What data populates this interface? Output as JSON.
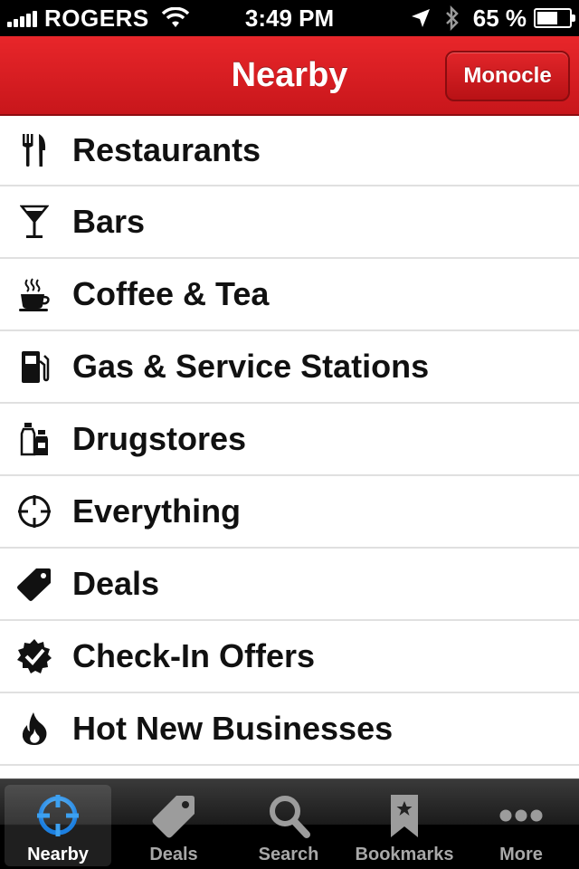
{
  "status_bar": {
    "carrier": "ROGERS",
    "time": "3:49 PM",
    "battery_percent": "65 %",
    "battery_level": 0.65
  },
  "navbar": {
    "title": "Nearby",
    "right_button": "Monocle",
    "accent_color": "#d71e22"
  },
  "categories": [
    {
      "label": "Restaurants",
      "icon": "fork-knife-icon"
    },
    {
      "label": "Bars",
      "icon": "cocktail-icon"
    },
    {
      "label": "Coffee & Tea",
      "icon": "coffee-cup-icon"
    },
    {
      "label": "Gas & Service Stations",
      "icon": "gas-pump-icon"
    },
    {
      "label": "Drugstores",
      "icon": "bottles-icon"
    },
    {
      "label": "Everything",
      "icon": "crosshair-icon"
    },
    {
      "label": "Deals",
      "icon": "price-tag-icon"
    },
    {
      "label": "Check-In Offers",
      "icon": "check-badge-icon"
    },
    {
      "label": "Hot New Businesses",
      "icon": "flame-icon"
    }
  ],
  "tabs": [
    {
      "label": "Nearby",
      "icon": "crosshair-icon",
      "active": true
    },
    {
      "label": "Deals",
      "icon": "price-tag-icon",
      "active": false
    },
    {
      "label": "Search",
      "icon": "search-icon",
      "active": false
    },
    {
      "label": "Bookmarks",
      "icon": "bookmark-icon",
      "active": false
    },
    {
      "label": "More",
      "icon": "more-dots-icon",
      "active": false
    }
  ]
}
